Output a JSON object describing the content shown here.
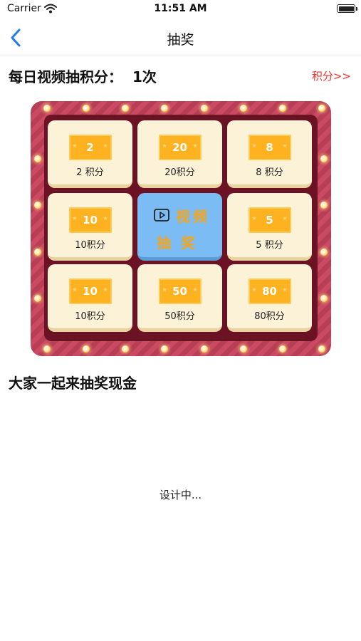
{
  "status_bar": {
    "carrier": "Carrier",
    "time": "11:51 AM"
  },
  "nav": {
    "title": "抽奖"
  },
  "daily": {
    "label": "每日视频抽积分：",
    "count": "1次"
  },
  "points_link": "积分>>",
  "lottery": {
    "prizes": [
      {
        "value": "2",
        "label": "2 积分"
      },
      {
        "value": "20",
        "label": "20积分"
      },
      {
        "value": "8",
        "label": "8 积分"
      },
      {
        "value": "10",
        "label": "10积分"
      },
      {
        "value": "5",
        "label": "5 积分"
      },
      {
        "value": "10",
        "label": "10积分"
      },
      {
        "value": "50",
        "label": "50积分"
      },
      {
        "value": "80",
        "label": "80积分"
      }
    ],
    "center": {
      "line1": "视频",
      "line2": "抽奖"
    }
  },
  "promo_text": "大家一起来抽奖现金",
  "placeholder_text": "设计中...",
  "colors": {
    "accent_link": "#f0312b",
    "back_arrow": "#1e7cf2",
    "ticket": "#ffb21f",
    "center": "#7bbcf4"
  }
}
